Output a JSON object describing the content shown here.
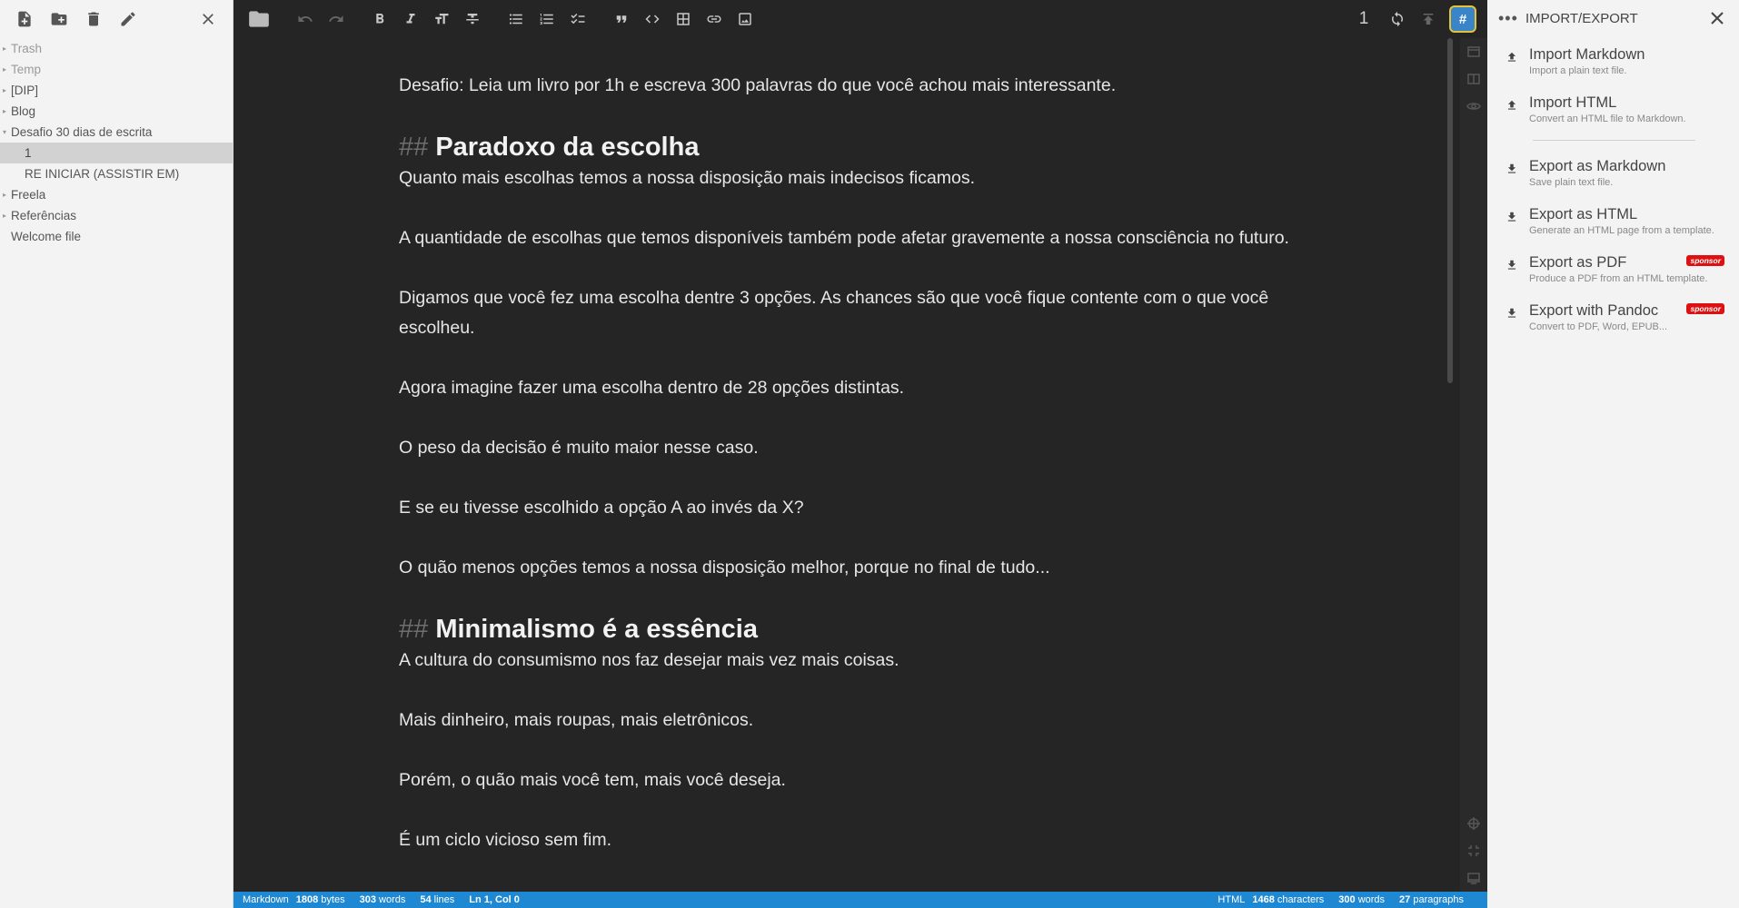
{
  "explorer": {
    "tree": [
      {
        "label": "Trash",
        "caret": "▸",
        "muted": true
      },
      {
        "label": "Temp",
        "caret": "▸",
        "muted": true
      },
      {
        "label": "[DIP]",
        "caret": "▸"
      },
      {
        "label": "Blog",
        "caret": "▸"
      },
      {
        "label": "Desafio 30 dias de escrita",
        "caret": "▾"
      },
      {
        "label": "1",
        "child": true,
        "selected": true
      },
      {
        "label": "RE INICIAR (ASSISTIR EM)",
        "child": true
      },
      {
        "label": "Freela",
        "caret": "▸"
      },
      {
        "label": "Referências",
        "caret": "▸"
      },
      {
        "label": "Welcome file"
      }
    ]
  },
  "navbar": {
    "count": "1",
    "active_glyph": "#"
  },
  "document": {
    "intro": "Desafio: Leia um livro por 1h e escreva 300 palavras do que você achou mais interessante.",
    "heading_mark": "##",
    "h1": "Paradoxo da escolha",
    "s1": [
      "Quanto mais escolhas temos a nossa disposição mais indecisos ficamos.",
      "A quantidade de escolhas que temos disponíveis também pode afetar gravemente a nossa consciência no futuro.",
      "Digamos que você fez uma escolha dentre 3 opções. As chances são que você fique contente com o que você escolheu.",
      "Agora imagine fazer uma escolha dentro de 28 opções distintas.",
      "O peso da decisão é muito maior nesse caso.",
      "E se eu tivesse escolhido a opção A ao invés da X?",
      "O quão menos opções temos a nossa disposição melhor, porque no final de tudo..."
    ],
    "h2": "Minimalismo é a essência",
    "s2": [
      "A cultura do consumismo nos faz desejar mais vez mais coisas.",
      "Mais dinheiro, mais roupas, mais eletrônicos.",
      "Porém, o quão mais você tem, mais você deseja.",
      "É um ciclo vicioso sem fim."
    ]
  },
  "status": {
    "mode": "Markdown",
    "bytes_n": "1808",
    "bytes_l": "bytes",
    "words_n": "303",
    "words_l": "words",
    "lines_n": "54",
    "lines_l": "lines",
    "pos": "Ln 1, Col 0",
    "r_mode": "HTML",
    "chars_n": "1468",
    "chars_l": "characters",
    "rwords_n": "300",
    "rwords_l": "words",
    "paras_n": "27",
    "paras_l": "paragraphs"
  },
  "panel": {
    "more": "•••",
    "title": "IMPORT/EXPORT",
    "import_items": [
      {
        "label": "Import Markdown",
        "desc": "Import a plain text file.",
        "icon": "upload-icon"
      },
      {
        "label": "Import HTML",
        "desc": "Convert an HTML file to Markdown.",
        "icon": "upload-icon"
      }
    ],
    "export_items": [
      {
        "label": "Export as Markdown",
        "desc": "Save plain text file.",
        "icon": "download-icon"
      },
      {
        "label": "Export as HTML",
        "desc": "Generate an HTML page from a template.",
        "icon": "download-icon"
      },
      {
        "label": "Export as PDF",
        "desc": "Produce a PDF from an HTML template.",
        "icon": "download-icon",
        "badge": "sponsor"
      },
      {
        "label": "Export with Pandoc",
        "desc": "Convert to PDF, Word, EPUB...",
        "icon": "download-icon",
        "badge": "sponsor"
      }
    ]
  },
  "colors": {
    "editor_bg": "#252525",
    "sidebar_bg": "#f3f3f3",
    "status_bar": "#1e88d2",
    "sponsor_badge": "#dd1111",
    "active_button": "#3a84c8"
  }
}
